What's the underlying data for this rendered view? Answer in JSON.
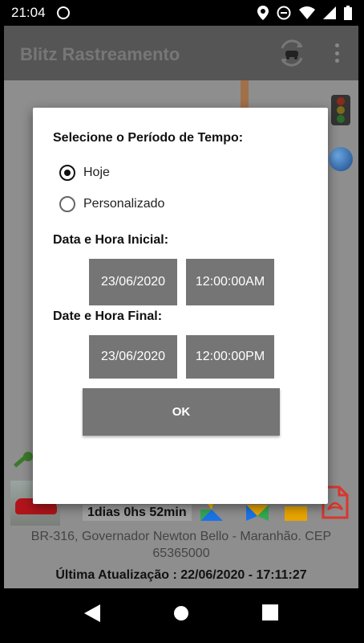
{
  "status_bar": {
    "time": "21:04"
  },
  "app_bar": {
    "title": "Blitz Rastreamento"
  },
  "background": {
    "duration_text": "1dias 0hs 52min",
    "address": "BR-316, Governador Newton Bello - Maranhão. CEP 65365000",
    "last_update": "Última Atualização : 22/06/2020 - 17:11:27"
  },
  "dialog": {
    "title": "Selecione o Período de Tempo:",
    "options": [
      {
        "label": "Hoje",
        "checked": true
      },
      {
        "label": "Personalizado",
        "checked": false
      }
    ],
    "start": {
      "label": "Data e Hora Inicial:",
      "date": "23/06/2020",
      "time": "12:00:00AM"
    },
    "end": {
      "label": "Date e Hora Final:",
      "date": "23/06/2020",
      "time": "12:00:00PM"
    },
    "ok_label": "OK"
  },
  "colors": {
    "button_gray": "#757575",
    "app_bar": "#555555",
    "accent_red": "#d9372e"
  }
}
